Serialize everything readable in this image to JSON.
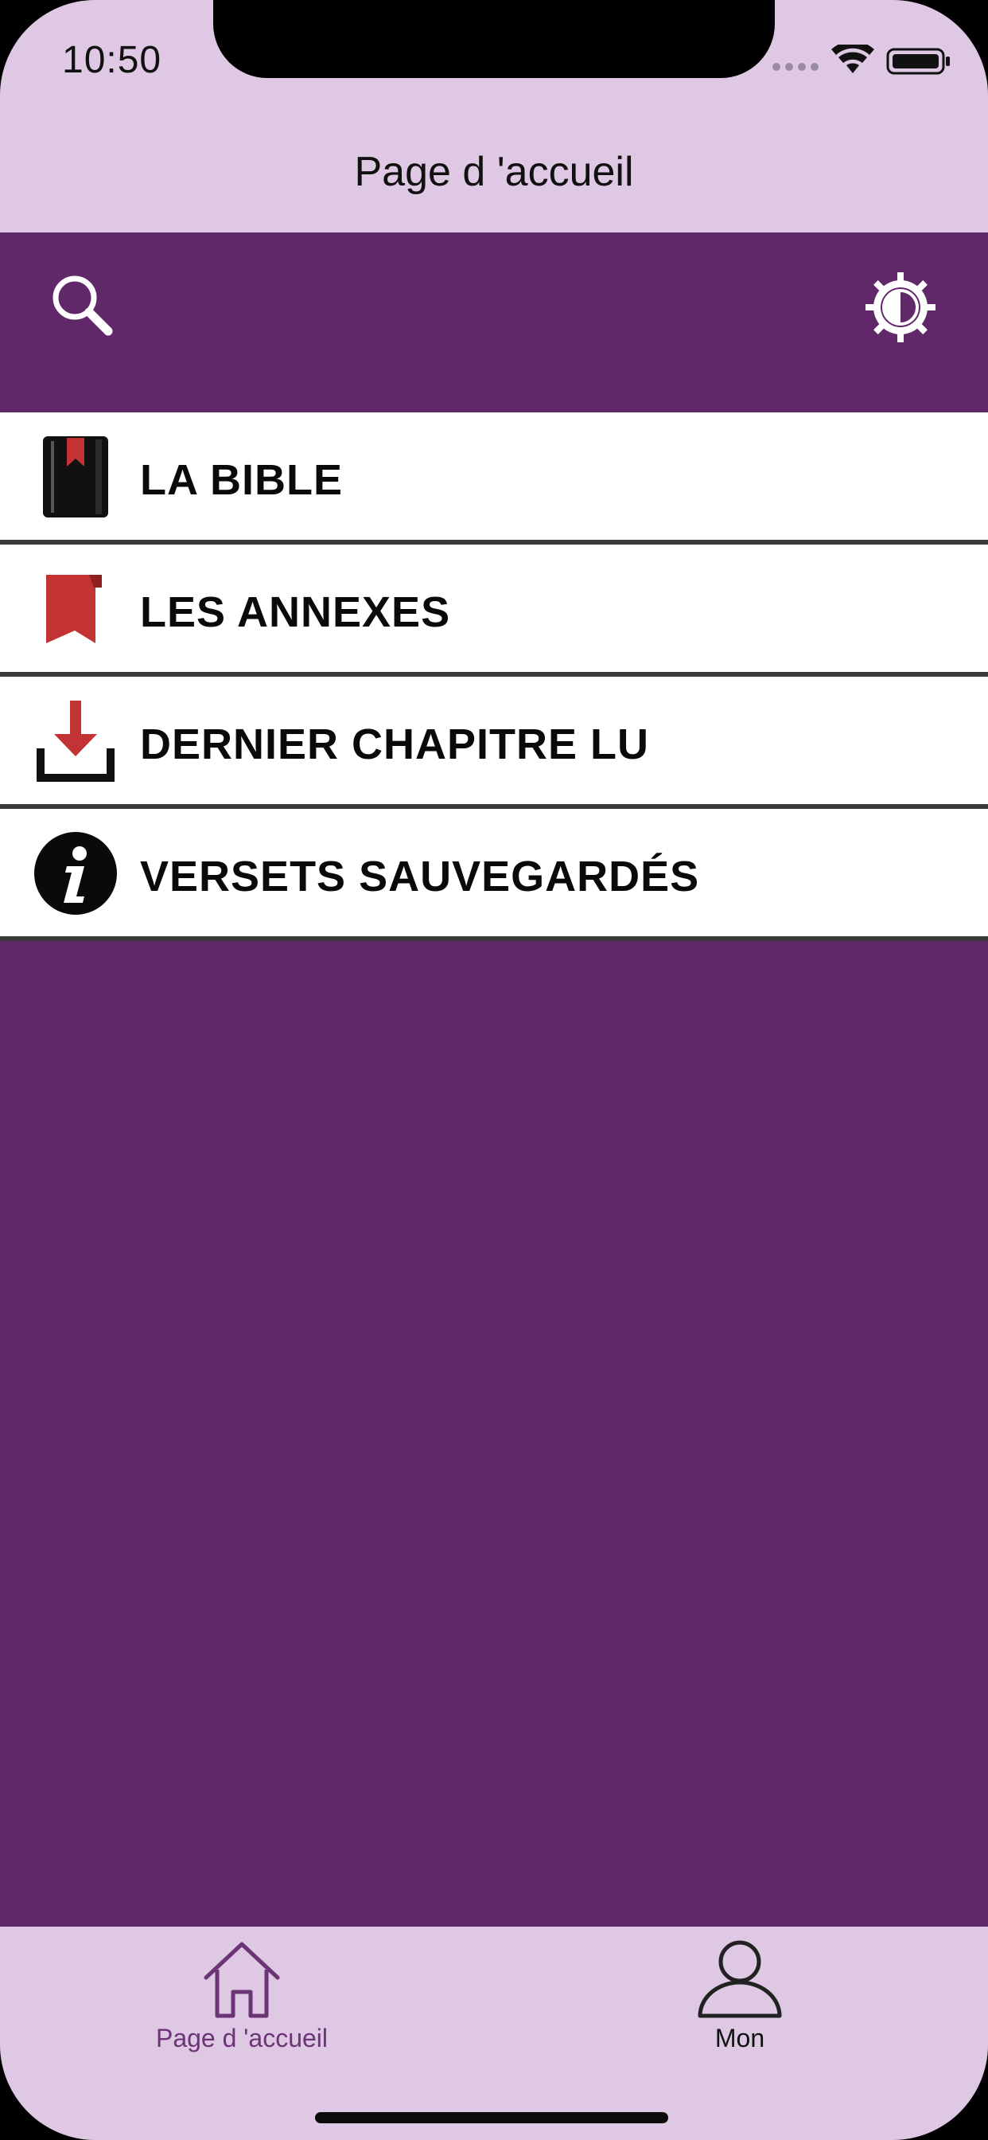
{
  "status_bar": {
    "time": "10:50"
  },
  "nav": {
    "title": "Page d 'accueil"
  },
  "toolbar": {
    "left_icon": "search-icon",
    "right_icon": "theme-toggle-icon"
  },
  "menu": {
    "items": [
      {
        "label": "LA BIBLE",
        "icon": "bible-book-icon"
      },
      {
        "label": "LES ANNEXES",
        "icon": "bookmark-icon"
      },
      {
        "label": "DERNIER CHAPITRE LU",
        "icon": "download-icon"
      },
      {
        "label": "VERSETS SAUVEGARDÉS",
        "icon": "info-icon"
      }
    ]
  },
  "tabbar": {
    "tabs": [
      {
        "label": "Page d 'accueil",
        "icon": "home-icon",
        "active": true
      },
      {
        "label": "Mon",
        "icon": "user-icon",
        "active": false
      }
    ]
  },
  "colors": {
    "primary": "#612869",
    "header_bg": "#dec8e3",
    "active_tab": "#6b3575",
    "icon_red": "#c33333"
  }
}
